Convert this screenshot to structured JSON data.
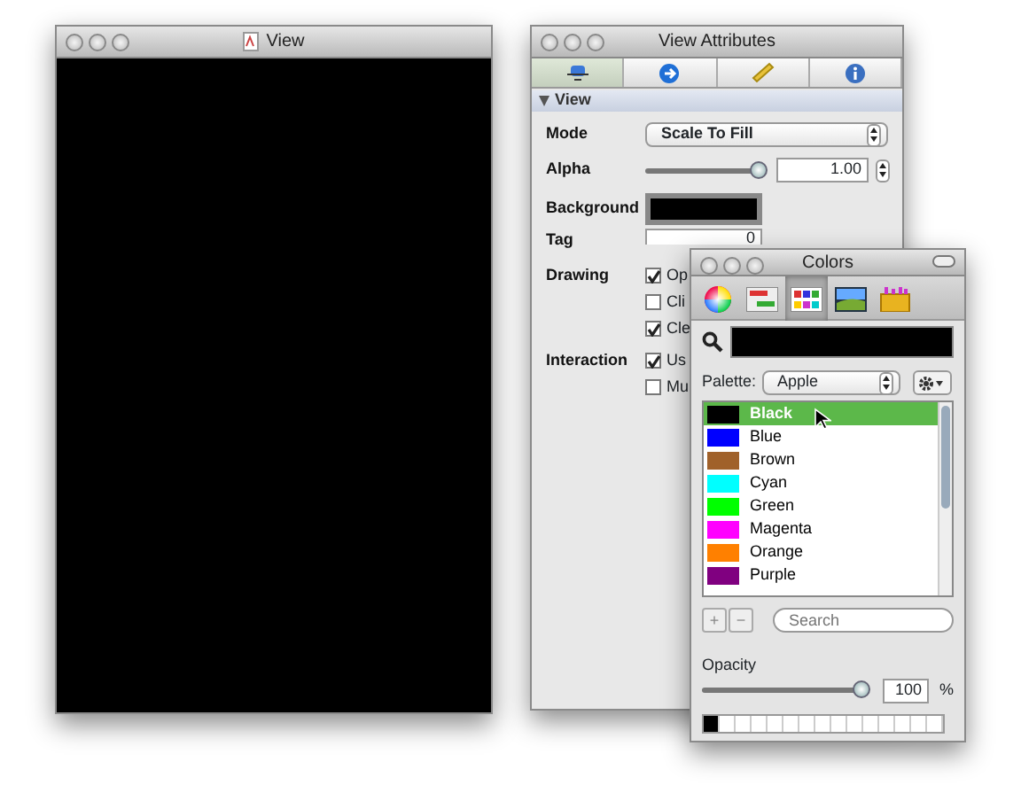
{
  "view_window": {
    "title": "View"
  },
  "attributes_window": {
    "title": "View Attributes",
    "tabs": [
      {
        "kind": "identity",
        "selected": true
      },
      {
        "kind": "connections",
        "selected": false
      },
      {
        "kind": "size",
        "selected": false
      },
      {
        "kind": "info",
        "selected": false
      }
    ],
    "section": {
      "title": "View",
      "expanded": true
    },
    "mode": {
      "label": "Mode",
      "value": "Scale To Fill"
    },
    "alpha": {
      "label": "Alpha",
      "level": 1.0,
      "value": "1.00"
    },
    "background": {
      "label": "Background",
      "color": "#000000"
    },
    "tag": {
      "label": "Tag",
      "value": "0"
    },
    "groups": [
      {
        "label": "Drawing",
        "options": [
          {
            "label": "Op",
            "checked": true
          },
          {
            "label": "Cli",
            "checked": false
          },
          {
            "label": "Cle",
            "checked": true
          }
        ]
      },
      {
        "label": "Interaction",
        "options": [
          {
            "label": "Us",
            "checked": true
          },
          {
            "label": "Mu",
            "checked": false
          }
        ]
      }
    ]
  },
  "colors_window": {
    "title": "Colors",
    "modes": [
      {
        "kind": "wheel",
        "selected": false
      },
      {
        "kind": "sliders",
        "selected": false
      },
      {
        "kind": "palettes",
        "selected": true
      },
      {
        "kind": "image",
        "selected": false
      },
      {
        "kind": "crayons",
        "selected": false
      }
    ],
    "well": {
      "color": "#000000"
    },
    "palette": {
      "label": "Palette:",
      "value": "Apple"
    },
    "colors": [
      {
        "name": "Black",
        "color": "#000000",
        "selected": true
      },
      {
        "name": "Blue",
        "color": "#0000ff",
        "selected": false
      },
      {
        "name": "Brown",
        "color": "#a0612a",
        "selected": false
      },
      {
        "name": "Cyan",
        "color": "#00ffff",
        "selected": false
      },
      {
        "name": "Green",
        "color": "#00ff00",
        "selected": false
      },
      {
        "name": "Magenta",
        "color": "#ff00ff",
        "selected": false
      },
      {
        "name": "Orange",
        "color": "#ff8000",
        "selected": false
      },
      {
        "name": "Purple",
        "color": "#800080",
        "selected": false
      }
    ],
    "add_button": "+",
    "remove_button": "−",
    "search": {
      "placeholder": "Search"
    },
    "opacity": {
      "label": "Opacity",
      "level": 1.0,
      "value": "100",
      "unit": "%"
    },
    "swatches": [
      {
        "color": "#000000"
      },
      {
        "color": "#ffffff"
      },
      {
        "color": "#ffffff"
      },
      {
        "color": "#ffffff"
      },
      {
        "color": "#ffffff"
      },
      {
        "color": "#ffffff"
      },
      {
        "color": "#ffffff"
      },
      {
        "color": "#ffffff"
      },
      {
        "color": "#ffffff"
      },
      {
        "color": "#ffffff"
      },
      {
        "color": "#ffffff"
      },
      {
        "color": "#ffffff"
      },
      {
        "color": "#ffffff"
      },
      {
        "color": "#ffffff"
      },
      {
        "color": "#ffffff"
      }
    ]
  }
}
